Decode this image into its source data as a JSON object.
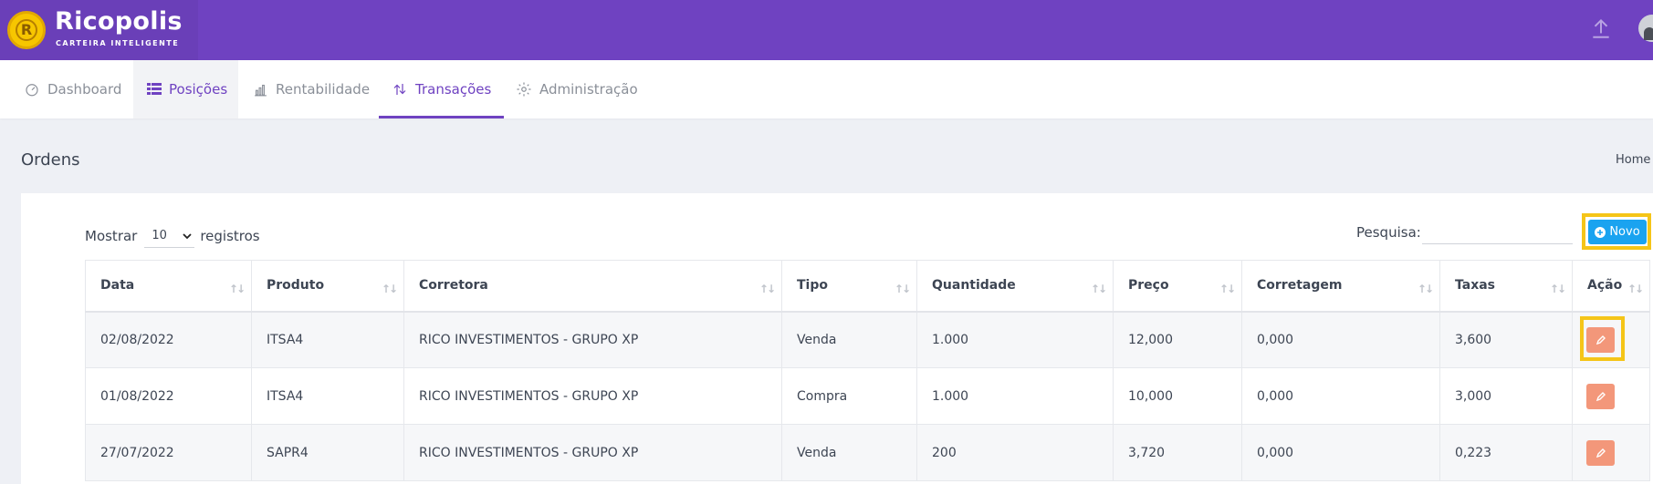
{
  "app": {
    "brand_title": "Ricopolis",
    "brand_subtitle": "CARTEIRA INTELIGENTE",
    "logo_letter": "R"
  },
  "colors": {
    "header": "#6f42c1",
    "accent": "#6f42c1",
    "novo_button": "#1aa3f0",
    "edit_button": "#f3977a",
    "highlight": "#f5c518"
  },
  "nav": {
    "items": [
      {
        "label": "Dashboard",
        "icon": "speedometer-icon"
      },
      {
        "label": "Posições",
        "icon": "grid-icon"
      },
      {
        "label": "Rentabilidade",
        "icon": "bar-chart-icon"
      },
      {
        "label": "Transações",
        "icon": "swap-arrows-icon"
      },
      {
        "label": "Administração",
        "icon": "gear-icon"
      }
    ],
    "active": "Transações"
  },
  "page": {
    "title": "Ordens",
    "breadcrumb": "Home"
  },
  "controls": {
    "show_label": "Mostrar",
    "show_value": "10",
    "records_label": "registros",
    "search_label": "Pesquisa:",
    "search_value": "",
    "new_button": "Novo"
  },
  "table": {
    "columns": [
      "Data",
      "Produto",
      "Corretora",
      "Tipo",
      "Quantidade",
      "Preço",
      "Corretagem",
      "Taxas",
      "Ação"
    ],
    "rows": [
      {
        "data": "02/08/2022",
        "produto": "ITSA4",
        "corretora": "RICO INVESTIMENTOS - GRUPO XP",
        "tipo": "Venda",
        "quantidade": "1.000",
        "preco": "12,000",
        "corretagem": "0,000",
        "taxas": "3,600"
      },
      {
        "data": "01/08/2022",
        "produto": "ITSA4",
        "corretora": "RICO INVESTIMENTOS - GRUPO XP",
        "tipo": "Compra",
        "quantidade": "1.000",
        "preco": "10,000",
        "corretagem": "0,000",
        "taxas": "3,000"
      },
      {
        "data": "27/07/2022",
        "produto": "SAPR4",
        "corretora": "RICO INVESTIMENTOS - GRUPO XP",
        "tipo": "Venda",
        "quantidade": "200",
        "preco": "3,720",
        "corretagem": "0,000",
        "taxas": "0,223"
      }
    ]
  }
}
